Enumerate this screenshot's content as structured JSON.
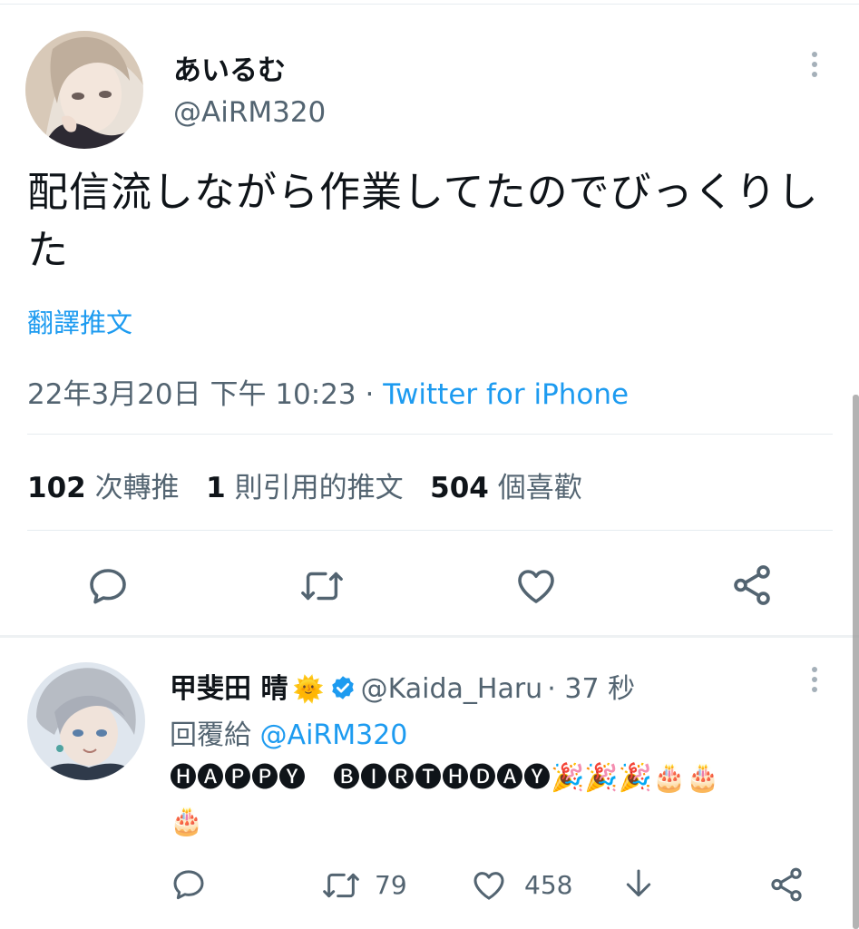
{
  "main_tweet": {
    "display_name": "あいるむ",
    "handle": "@AiRM320",
    "text": "配信流しながら作業してたのでびっくりした",
    "translate_label": "翻譯推文",
    "date_time": "22年3月20日 下午 10:23 · ",
    "source": "Twitter for iPhone",
    "stats": {
      "retweets_count": "102",
      "retweets_label": "次轉推",
      "quotes_count": "1",
      "quotes_label": "則引用的推文",
      "likes_count": "504",
      "likes_label": "個喜歡"
    },
    "actions": [
      "reply-icon",
      "retweet-icon",
      "like-icon",
      "share-icon"
    ]
  },
  "reply_tweet": {
    "display_name": "甲斐田 晴",
    "name_emoji": "🌞",
    "verified": true,
    "handle": "@Kaida_Haru",
    "time": "· 37 秒",
    "reply_prefix": "回覆給 ",
    "reply_mention": "@AiRM320",
    "text_line1": "🅗🅐🅟🅟🅨　🅑🅘🅡🅣🅗🅓🅐🅨🎉🎉🎉🎂🎂",
    "text_line2": "🎂",
    "retweet_count": "79",
    "like_count": "458"
  },
  "colors": {
    "accent": "#1d9bf0",
    "secondary_text": "#536471",
    "divider": "#e6ecf0",
    "verified": "#1d9bf0"
  }
}
